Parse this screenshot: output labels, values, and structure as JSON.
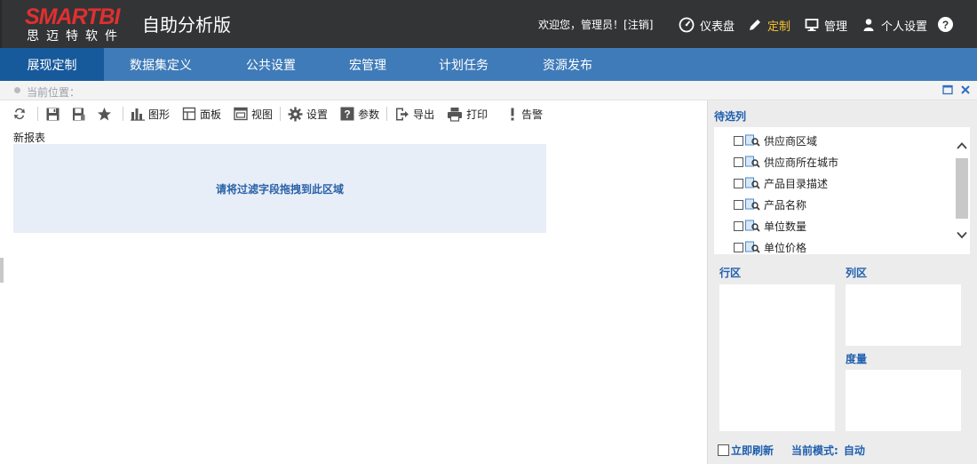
{
  "header": {
    "logo_main": "SMARTBI",
    "logo_sub": "思迈特软件",
    "app_title": "自助分析版",
    "welcome_prefix": "欢迎您，管理员！[",
    "logout": "注销",
    "welcome_suffix": "]",
    "items": [
      {
        "label": "仪表盘",
        "icon": "dashboard-icon"
      },
      {
        "label": "定制",
        "icon": "pencil-icon",
        "active": true
      },
      {
        "label": "管理",
        "icon": "monitor-icon"
      },
      {
        "label": "个人设置",
        "icon": "user-icon"
      }
    ],
    "help": "?"
  },
  "nav": {
    "tabs": [
      "展现定制",
      "数据集定义",
      "公共设置",
      "宏管理",
      "计划任务",
      "资源发布"
    ],
    "active_index": 0
  },
  "location": {
    "label": "当前位置："
  },
  "toolbar": {
    "chart": "图形",
    "panel": "面板",
    "view": "视图",
    "settings": "设置",
    "params": "参数",
    "export": "导出",
    "print": "打印",
    "alert": "告警"
  },
  "report": {
    "name": "新报表",
    "filter_hint": "请将过滤字段拖拽到此区域"
  },
  "right_panel": {
    "candidate_title": "待选列",
    "fields": [
      "供应商区域",
      "供应商所在城市",
      "产品目录描述",
      "产品名称",
      "单位数量",
      "单位价格"
    ],
    "row_area": "行区",
    "col_area": "列区",
    "measure": "度量",
    "instant_refresh": "立即刷新",
    "mode_label": "当前模式:",
    "mode_value": "自动"
  },
  "colors": {
    "header_bg": "#333436",
    "nav_bg": "#3f7bb9",
    "nav_active": "#175a9c",
    "accent_yellow": "#f4c030",
    "logo_red": "#e03030",
    "link_blue": "#1e5fae"
  }
}
